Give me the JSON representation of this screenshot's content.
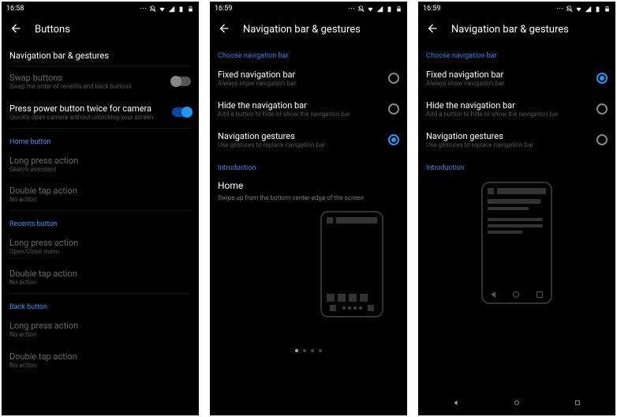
{
  "screens": [
    {
      "status": {
        "time": "16:58",
        "icons": [
          "more",
          "silent",
          "wifi",
          "signal",
          "battery",
          "lock"
        ]
      },
      "header": {
        "title": "Buttons"
      },
      "top_section": "Navigation bar & gestures",
      "items": [
        {
          "title": "Swap buttons",
          "sub": "Swap the order of recents and back buttons",
          "disabled": true,
          "toggle": "off"
        },
        {
          "title": "Press power button twice for camera",
          "sub": "Quickly open camera without unlocking your screen",
          "disabled": false,
          "toggle": "on"
        }
      ],
      "groups": [
        {
          "label": "Home button",
          "rows": [
            {
              "title": "Long press action",
              "sub": "Search assistant",
              "disabled": true
            },
            {
              "title": "Double tap action",
              "sub": "No action",
              "disabled": true
            }
          ]
        },
        {
          "label": "Recents button",
          "rows": [
            {
              "title": "Long press action",
              "sub": "Open/close menu",
              "disabled": true
            },
            {
              "title": "Double tap action",
              "sub": "No action",
              "disabled": true
            }
          ]
        },
        {
          "label": "Back button",
          "rows": [
            {
              "title": "Long press action",
              "sub": "No action",
              "disabled": true
            },
            {
              "title": "Double tap action",
              "sub": "No action",
              "disabled": true
            }
          ]
        }
      ]
    },
    {
      "status": {
        "time": "16:59",
        "icons": [
          "more",
          "silent",
          "wifi",
          "signal",
          "battery",
          "lock"
        ]
      },
      "header": {
        "title": "Navigation bar & gestures"
      },
      "choose_label": "Choose navigation bar",
      "radios": [
        {
          "title": "Fixed navigation bar",
          "sub": "Always show navigation bar",
          "checked": false
        },
        {
          "title": "Hide the navigation bar",
          "sub": "Add a button to hide or show the navigation bar",
          "checked": false
        },
        {
          "title": "Navigation gestures",
          "sub": "Use gestures to replace navigation bar",
          "checked": true
        }
      ],
      "intro_label": "Introduction",
      "home_label": "Home",
      "home_sub": "Swipe up from the bottom center edge of the screen",
      "pager": {
        "count": 4,
        "active": 0
      }
    },
    {
      "status": {
        "time": "16:59",
        "icons": [
          "more",
          "silent",
          "wifi",
          "signal",
          "battery",
          "lock"
        ]
      },
      "header": {
        "title": "Navigation bar & gestures"
      },
      "choose_label": "Choose navigation bar",
      "radios": [
        {
          "title": "Fixed navigation bar",
          "sub": "Always show navigation bar",
          "checked": true
        },
        {
          "title": "Hide the navigation bar",
          "sub": "Add a button to hide or show the navigation bar",
          "checked": false
        },
        {
          "title": "Navigation gestures",
          "sub": "Use gestures to replace navigation bar",
          "checked": false
        }
      ],
      "intro_label": "Introduction",
      "softkeys": [
        "back",
        "home",
        "recents"
      ]
    }
  ]
}
